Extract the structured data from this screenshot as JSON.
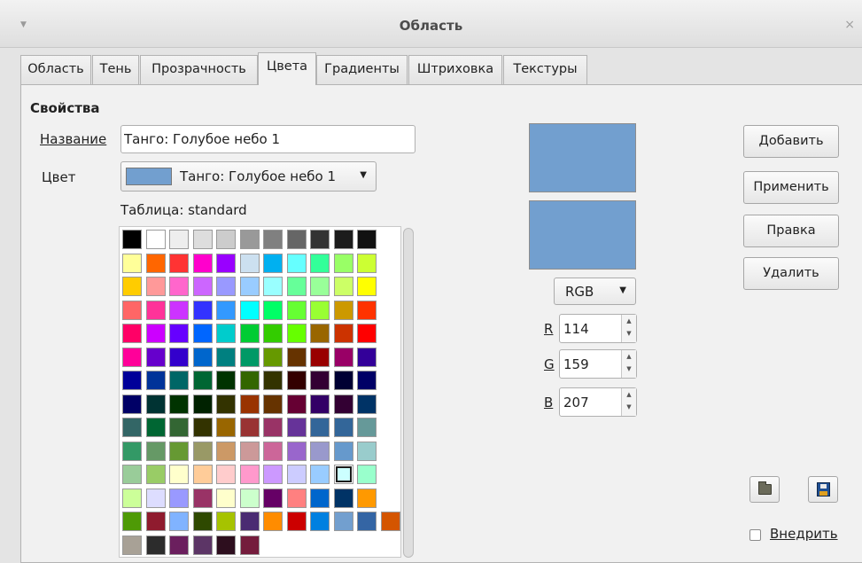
{
  "window": {
    "title": "Область",
    "menu_glyph": "▼",
    "close_glyph": "×"
  },
  "tabs": [
    {
      "label": "Область"
    },
    {
      "label": "Тень"
    },
    {
      "label": "Прозрачность"
    },
    {
      "label": "Цвета",
      "active": true
    },
    {
      "label": "Градиенты"
    },
    {
      "label": "Штриховка"
    },
    {
      "label": "Текстуры"
    }
  ],
  "properties": {
    "section_title": "Свойства",
    "name_label": "Название",
    "name_value": "Танго: Голубое небо 1",
    "color_label": "Цвет",
    "color_value": "Танго: Голубое небо 1",
    "color_swatch": "#729fcf",
    "table_label": "Таблица: standard"
  },
  "preview": {
    "old_color": "#729fcf",
    "new_color": "#729fcf"
  },
  "color_model": {
    "value": "RGB"
  },
  "rgb": {
    "r_label": "R",
    "r_value": "114",
    "g_label": "G",
    "g_value": "159",
    "b_label": "B",
    "b_value": "207"
  },
  "buttons": {
    "add": "Добавить",
    "apply": "Применить",
    "edit": "Правка",
    "delete": "Удалить"
  },
  "icons": {
    "load": "folder-icon",
    "save": "disk-icon"
  },
  "embed": {
    "label": "Внедрить",
    "checked": false
  },
  "palette": {
    "selected": [
      11,
      10
    ],
    "rows": [
      [
        "#000000",
        "#ffffff",
        "#eeeeee",
        "#dddddd",
        "#cccccc",
        "#999999",
        "#808080",
        "#666666",
        "#333333",
        "#1c1c1c",
        "#111111"
      ],
      [
        "#ffff99",
        "#ff6600",
        "#ff3333",
        "#ff00cc",
        "#9900ff",
        "#cce0f0",
        "#00b0f0",
        "#66ffff",
        "#33ff99",
        "#99ff66",
        "#ccff33"
      ],
      [
        "#ffcc00",
        "#ff9999",
        "#ff66cc",
        "#cc66ff",
        "#9999ff",
        "#99ccff",
        "#99ffff",
        "#66ff99",
        "#99ff99",
        "#ccff66",
        "#ffff00"
      ],
      [
        "#ff6666",
        "#ff3399",
        "#cc33ff",
        "#3333ff",
        "#3399ff",
        "#00ffff",
        "#00ff66",
        "#66ff33",
        "#99ff33",
        "#cc9900",
        "#ff3300"
      ],
      [
        "#ff0066",
        "#cc00ff",
        "#6600ff",
        "#0066ff",
        "#00cccc",
        "#00cc33",
        "#33cc00",
        "#66ff00",
        "#996600",
        "#cc3300",
        "#ff0000"
      ],
      [
        "#ff0099",
        "#6600cc",
        "#3300cc",
        "#0066cc",
        "#008080",
        "#009966",
        "#669900",
        "#663300",
        "#990000",
        "#990066",
        "#330099"
      ],
      [
        "#000099",
        "#003399",
        "#006666",
        "#006633",
        "#003300",
        "#336600",
        "#333300",
        "#330000",
        "#330033",
        "#000033",
        "#000066"
      ],
      [
        "#000066",
        "#003333",
        "#003300",
        "#002200",
        "#333300",
        "#993300",
        "#663300",
        "#660033",
        "#330066",
        "#330033",
        "#003366"
      ],
      [
        "#336666",
        "#006633",
        "#336633",
        "#333300",
        "#996600",
        "#993333",
        "#993366",
        "#663399",
        "#336699",
        "#336699",
        "#669999"
      ],
      [
        "#339966",
        "#669966",
        "#669933",
        "#999966",
        "#cc9966",
        "#cc9999",
        "#cc6699",
        "#9966cc",
        "#9999cc",
        "#6699cc",
        "#99cccc"
      ],
      [
        "#99cc99",
        "#99cc66",
        "#ffffcc",
        "#ffcc99",
        "#ffcccc",
        "#ff99cc",
        "#cc99ff",
        "#ccccff",
        "#99ccff",
        "#ccffff",
        "#99ffcc"
      ],
      [
        "#ccff99",
        "#ddddff",
        "#9999ff",
        "#993366",
        "#ffffcc",
        "#ccffcc",
        "#660066",
        "#ff8080",
        "#0066cc",
        "#003366",
        "#ff9900"
      ],
      [
        "#4e9a06",
        "#8f1b2e",
        "#80b3ff",
        "#2e4900",
        "#a6c300",
        "#4a2b72",
        "#ff8c00",
        "#cc0000",
        "#0080e0",
        "#729fcf",
        "#3465a4",
        "#d45500"
      ],
      [
        "#a8a196",
        "#2c2c2c",
        "#6b1f5e",
        "#5c3566",
        "#2d0e1e",
        "#741c3c"
      ]
    ]
  }
}
